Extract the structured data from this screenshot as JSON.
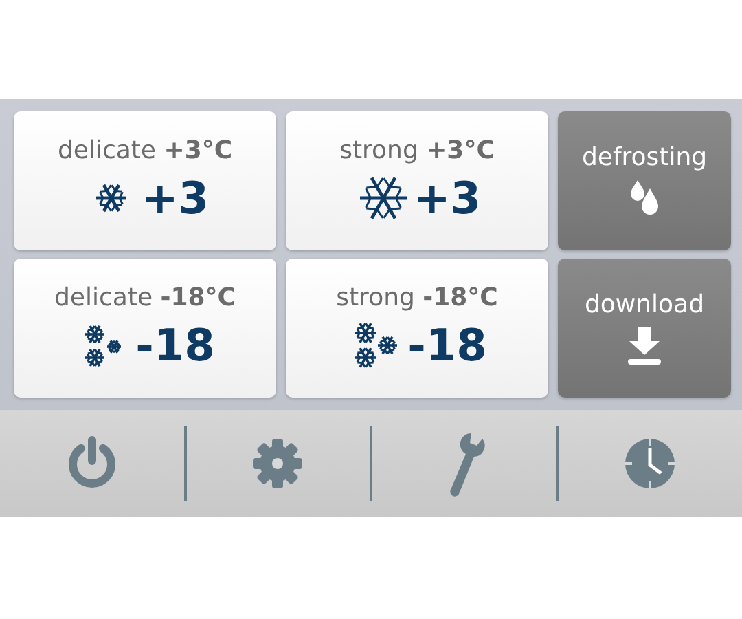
{
  "programs": [
    {
      "label": "delicate **+3°C**",
      "value": "+3",
      "kind": "single"
    },
    {
      "label": "strong **+3°C**",
      "value": "+3",
      "kind": "large"
    },
    {
      "label": "delicate **-18°C**",
      "value": "-18",
      "kind": "pair"
    },
    {
      "label": "strong **-18°C**",
      "value": "-18",
      "kind": "triple"
    }
  ],
  "actions": [
    {
      "label": "defrosting",
      "kind": "drops"
    },
    {
      "label": "download",
      "kind": "download"
    }
  ],
  "toolbar": [
    {
      "kind": "power"
    },
    {
      "kind": "settings"
    },
    {
      "kind": "wrench"
    },
    {
      "kind": "clock"
    }
  ]
}
